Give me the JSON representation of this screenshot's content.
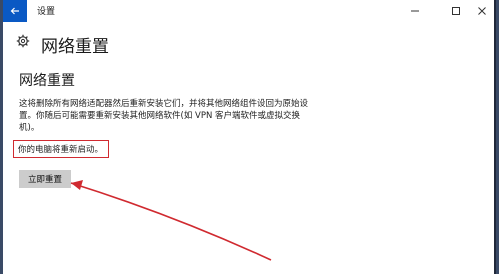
{
  "window": {
    "title": "设置"
  },
  "header": {
    "title": "网络重置",
    "icon": "gear-icon"
  },
  "section": {
    "title": "网络重置",
    "description": "这将删除所有网络适配器然后重新安装它们，并将其他网络组件设回为原始设置。你随后可能需要重新安装其他网络软件(如 VPN 客户端软件或虚拟交换机)。",
    "restart_notice": "你的电脑将重新启动。"
  },
  "actions": {
    "reset_now_label": "立即重置"
  },
  "colors": {
    "accent": "#0a59c4",
    "annotation": "#d02a30",
    "button_bg": "#cccccc"
  }
}
